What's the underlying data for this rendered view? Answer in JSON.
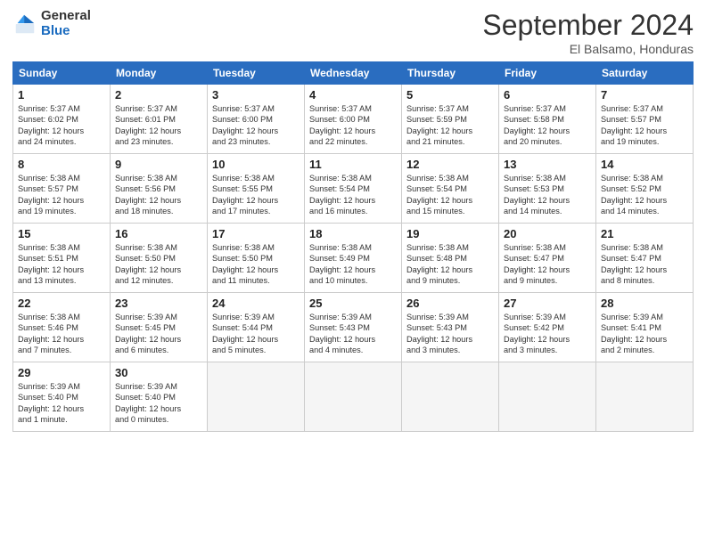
{
  "header": {
    "logo_general": "General",
    "logo_blue": "Blue",
    "month_title": "September 2024",
    "subtitle": "El Balsamo, Honduras"
  },
  "weekdays": [
    "Sunday",
    "Monday",
    "Tuesday",
    "Wednesday",
    "Thursday",
    "Friday",
    "Saturday"
  ],
  "weeks": [
    [
      {
        "day": "1",
        "info": "Sunrise: 5:37 AM\nSunset: 6:02 PM\nDaylight: 12 hours\nand 24 minutes."
      },
      {
        "day": "2",
        "info": "Sunrise: 5:37 AM\nSunset: 6:01 PM\nDaylight: 12 hours\nand 23 minutes."
      },
      {
        "day": "3",
        "info": "Sunrise: 5:37 AM\nSunset: 6:00 PM\nDaylight: 12 hours\nand 23 minutes."
      },
      {
        "day": "4",
        "info": "Sunrise: 5:37 AM\nSunset: 6:00 PM\nDaylight: 12 hours\nand 22 minutes."
      },
      {
        "day": "5",
        "info": "Sunrise: 5:37 AM\nSunset: 5:59 PM\nDaylight: 12 hours\nand 21 minutes."
      },
      {
        "day": "6",
        "info": "Sunrise: 5:37 AM\nSunset: 5:58 PM\nDaylight: 12 hours\nand 20 minutes."
      },
      {
        "day": "7",
        "info": "Sunrise: 5:37 AM\nSunset: 5:57 PM\nDaylight: 12 hours\nand 19 minutes."
      }
    ],
    [
      {
        "day": "8",
        "info": "Sunrise: 5:38 AM\nSunset: 5:57 PM\nDaylight: 12 hours\nand 19 minutes."
      },
      {
        "day": "9",
        "info": "Sunrise: 5:38 AM\nSunset: 5:56 PM\nDaylight: 12 hours\nand 18 minutes."
      },
      {
        "day": "10",
        "info": "Sunrise: 5:38 AM\nSunset: 5:55 PM\nDaylight: 12 hours\nand 17 minutes."
      },
      {
        "day": "11",
        "info": "Sunrise: 5:38 AM\nSunset: 5:54 PM\nDaylight: 12 hours\nand 16 minutes."
      },
      {
        "day": "12",
        "info": "Sunrise: 5:38 AM\nSunset: 5:54 PM\nDaylight: 12 hours\nand 15 minutes."
      },
      {
        "day": "13",
        "info": "Sunrise: 5:38 AM\nSunset: 5:53 PM\nDaylight: 12 hours\nand 14 minutes."
      },
      {
        "day": "14",
        "info": "Sunrise: 5:38 AM\nSunset: 5:52 PM\nDaylight: 12 hours\nand 14 minutes."
      }
    ],
    [
      {
        "day": "15",
        "info": "Sunrise: 5:38 AM\nSunset: 5:51 PM\nDaylight: 12 hours\nand 13 minutes."
      },
      {
        "day": "16",
        "info": "Sunrise: 5:38 AM\nSunset: 5:50 PM\nDaylight: 12 hours\nand 12 minutes."
      },
      {
        "day": "17",
        "info": "Sunrise: 5:38 AM\nSunset: 5:50 PM\nDaylight: 12 hours\nand 11 minutes."
      },
      {
        "day": "18",
        "info": "Sunrise: 5:38 AM\nSunset: 5:49 PM\nDaylight: 12 hours\nand 10 minutes."
      },
      {
        "day": "19",
        "info": "Sunrise: 5:38 AM\nSunset: 5:48 PM\nDaylight: 12 hours\nand 9 minutes."
      },
      {
        "day": "20",
        "info": "Sunrise: 5:38 AM\nSunset: 5:47 PM\nDaylight: 12 hours\nand 9 minutes."
      },
      {
        "day": "21",
        "info": "Sunrise: 5:38 AM\nSunset: 5:47 PM\nDaylight: 12 hours\nand 8 minutes."
      }
    ],
    [
      {
        "day": "22",
        "info": "Sunrise: 5:38 AM\nSunset: 5:46 PM\nDaylight: 12 hours\nand 7 minutes."
      },
      {
        "day": "23",
        "info": "Sunrise: 5:39 AM\nSunset: 5:45 PM\nDaylight: 12 hours\nand 6 minutes."
      },
      {
        "day": "24",
        "info": "Sunrise: 5:39 AM\nSunset: 5:44 PM\nDaylight: 12 hours\nand 5 minutes."
      },
      {
        "day": "25",
        "info": "Sunrise: 5:39 AM\nSunset: 5:43 PM\nDaylight: 12 hours\nand 4 minutes."
      },
      {
        "day": "26",
        "info": "Sunrise: 5:39 AM\nSunset: 5:43 PM\nDaylight: 12 hours\nand 3 minutes."
      },
      {
        "day": "27",
        "info": "Sunrise: 5:39 AM\nSunset: 5:42 PM\nDaylight: 12 hours\nand 3 minutes."
      },
      {
        "day": "28",
        "info": "Sunrise: 5:39 AM\nSunset: 5:41 PM\nDaylight: 12 hours\nand 2 minutes."
      }
    ],
    [
      {
        "day": "29",
        "info": "Sunrise: 5:39 AM\nSunset: 5:40 PM\nDaylight: 12 hours\nand 1 minute."
      },
      {
        "day": "30",
        "info": "Sunrise: 5:39 AM\nSunset: 5:40 PM\nDaylight: 12 hours\nand 0 minutes."
      },
      null,
      null,
      null,
      null,
      null
    ]
  ]
}
